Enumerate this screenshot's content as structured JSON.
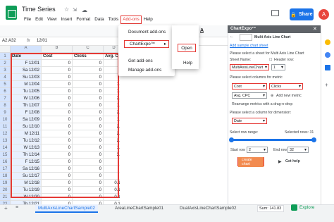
{
  "title": "Time Series",
  "menus": [
    "File",
    "Edit",
    "View",
    "Insert",
    "Format",
    "Data",
    "Tools",
    "Add-ons",
    "Help"
  ],
  "share_label": "Share",
  "avatar_letter": "A",
  "namebox": "A2:A32",
  "formula": "12/01",
  "columns": [
    "A",
    "B",
    "C",
    "D"
  ],
  "headers": [
    "Date",
    "Cost",
    "Clicks",
    "Avg. C"
  ],
  "rows": [
    [
      "F 12/01",
      "0",
      "0",
      "0"
    ],
    [
      "Sa 12/02",
      "0",
      "0",
      "0"
    ],
    [
      "Su 12/03",
      "0",
      "0",
      "0"
    ],
    [
      "M 12/04",
      "0",
      "0",
      "1.8"
    ],
    [
      "Tu 12/05",
      "0",
      "0",
      "1.9"
    ],
    [
      "W 12/06",
      "0",
      "0",
      "2.1"
    ],
    [
      "Th 12/07",
      "0",
      "0",
      "1.9"
    ],
    [
      "F 12/08",
      "0",
      "0",
      "2.1"
    ],
    [
      "Sa 12/09",
      "0",
      "0",
      "1.5"
    ],
    [
      "Su 12/10",
      "0",
      "0",
      "2.3"
    ],
    [
      "M 12/11",
      "0",
      "0",
      "2.8"
    ],
    [
      "Tu 12/12",
      "0",
      "0",
      "2.8"
    ],
    [
      "W 12/13",
      "0",
      "0",
      "1.9"
    ],
    [
      "Th 12/14",
      "0",
      "0",
      "3.2"
    ],
    [
      "F 12/15",
      "0",
      "0",
      "0"
    ],
    [
      "Sa 12/16",
      "0",
      "0",
      "0"
    ],
    [
      "Su 12/17",
      "0",
      "0",
      "0"
    ],
    [
      "M 12/18",
      "0",
      "0",
      "0.15"
    ],
    [
      "Tu 12/19",
      "0",
      "0",
      "0.15"
    ],
    [
      "W 12/20",
      "0",
      "0",
      "0.15"
    ],
    [
      "Th 12/21",
      "0",
      "0",
      "0.15"
    ]
  ],
  "row_numbers": [
    "1",
    "2",
    "3",
    "4",
    "5",
    "6",
    "7",
    "8",
    "9",
    "10",
    "11",
    "12",
    "13",
    "14",
    "15",
    "16",
    "17",
    "18",
    "19",
    "20",
    "21",
    "22"
  ],
  "addons_menu": {
    "items": [
      "Document add-ons",
      "ChartExpo™",
      "Get add-ons",
      "Manage add-ons"
    ]
  },
  "cx_menu": {
    "items": [
      "Open",
      "Help"
    ]
  },
  "sidebar": {
    "title": "ChartExpo™",
    "chart_type": "Multi Axis Line Chart",
    "add_sample": "Add sample chart sheet",
    "select_sheet": "Please select a sheet for Multi Axis Line Chart",
    "sheet_name_label": "Sheet Name:",
    "header_row_label": "Header row:",
    "sheet_value": "MultiAxisLineChart",
    "header_value": "1",
    "metric_label": "Please select columns for metric",
    "metric1": "Cost",
    "metric2": "Clicks",
    "metric3": "Avg. CPC",
    "add_metric": "Add new metric",
    "rearrange": "Rearrange metrics with a drag-n-drop",
    "dimension_label": "Please select a column for dimension:",
    "dimension_value": "Date",
    "row_range_label": "Select row range:",
    "selected_rows": "Selected rows: 31",
    "start_row_label": "Start row",
    "start_row": "2",
    "end_row_label": "End row",
    "end_row": "32",
    "create_label": "create chart",
    "help_label": "Get help"
  },
  "tabs": [
    "MultiAxisLineChartSample02",
    "AreaLineChartSample01",
    "DualAxisLineChartSample02"
  ],
  "sum_label": "Sum: 141.83",
  "explore_label": "Explore",
  "colors": {
    "accent": "#1a73e8",
    "highlight": "#e53935",
    "sheets_green": "#0f9d58"
  }
}
